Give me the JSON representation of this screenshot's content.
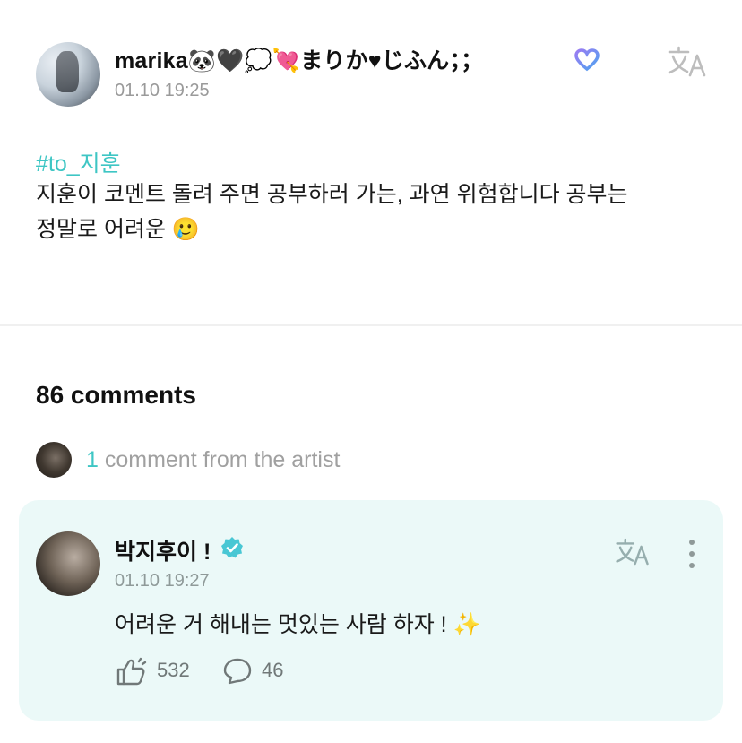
{
  "post": {
    "author_name": "marika",
    "author_emojis": "🐼🖤💭💘",
    "author_suffix": "まりか♥じふん；；",
    "timestamp": "01.10 19:25",
    "hashtag": "#to_지훈",
    "body_line1": "지훈이 코멘트 돌려 주면 공부하러 가는, 과연 위험합니다 공부는",
    "body_line2": "정말로 어려운 🥲"
  },
  "comments": {
    "count_label": "86 comments",
    "artist_count": "1",
    "artist_label": " comment from the artist"
  },
  "artist_comment": {
    "name": "박지후이 !",
    "timestamp": "01.10 19:27",
    "text": "어려운 거 해내는 멋있는 사람 하자 ! ✨",
    "likes": "532",
    "replies": "46"
  },
  "colors": {
    "accent": "#3ec6c4",
    "card_bg": "#ebf9f8",
    "verified": "#49c7d4"
  },
  "icons": [
    "heart-badge-icon",
    "translate-icon",
    "verified-icon",
    "more-icon",
    "like-icon",
    "reply-icon"
  ]
}
